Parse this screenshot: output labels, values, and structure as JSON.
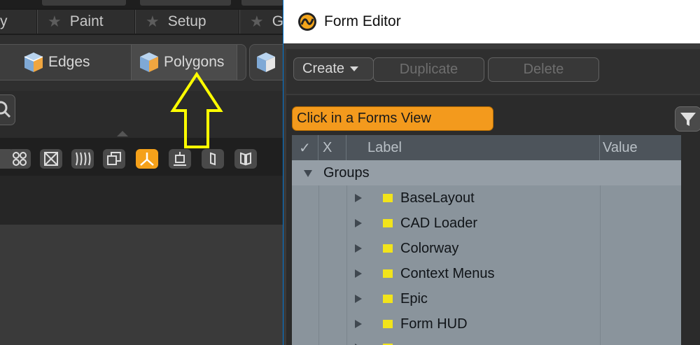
{
  "left_app": {
    "layout_tabs": [
      {
        "label": "y",
        "starred": false
      },
      {
        "label": "Paint",
        "starred": true
      },
      {
        "label": "Setup",
        "starred": true
      },
      {
        "label": "Ga",
        "starred": true
      }
    ],
    "selection_modes": [
      {
        "label": "Edges",
        "icon": "cube-edges-icon"
      },
      {
        "label": "Polygons",
        "icon": "cube-polygons-icon",
        "selected": true
      }
    ],
    "tool_icons": [
      "grid-icon",
      "x-icon",
      "wave-icon",
      "copy-icon",
      "symmetry-icon",
      "pivot-icon",
      "bracket-icon",
      "mirror-icon"
    ],
    "active_tool_index": 5,
    "annotation_color": "#ffff00"
  },
  "form_editor": {
    "title": "Form Editor",
    "toolbar": {
      "create_label": "Create",
      "duplicate_label": "Duplicate",
      "delete_label": "Delete"
    },
    "forms_view_placeholder": "Click in a Forms View",
    "accent_color": "#f39a1d",
    "tree": {
      "columns": [
        "✓",
        "X",
        "Label",
        "Value"
      ],
      "root": "Groups",
      "children": [
        "BaseLayout",
        "CAD Loader",
        "Colorway",
        "Context Menus",
        "Epic",
        "Form HUD"
      ],
      "folder_color": "#f2e41b"
    }
  }
}
